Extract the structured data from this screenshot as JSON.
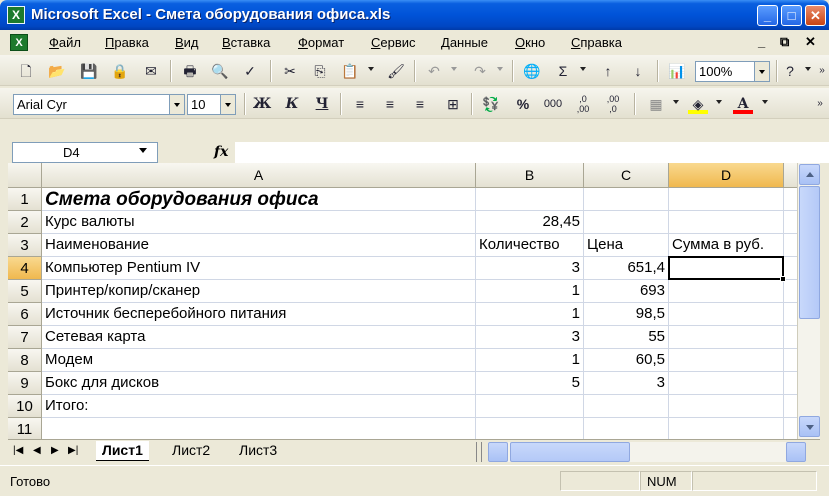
{
  "window": {
    "title": "Microsoft Excel - Смета оборудования офиса.xls",
    "app_icon": "X"
  },
  "menu": {
    "items": [
      "Файл",
      "Правка",
      "Вид",
      "Вставка",
      "Формат",
      "Сервис",
      "Данные",
      "Окно",
      "Справка"
    ],
    "doc_controls": {
      "min": "_",
      "restore": "ā",
      "close": "×"
    }
  },
  "toolbar1": {
    "zoom": "100%"
  },
  "toolbar2": {
    "font_name": "Arial Cyr",
    "font_size": "10",
    "bold": "Ж",
    "italic": "К",
    "underline": "Ч",
    "percent": "%",
    "thousands": "000",
    "inc_decimal": ",0 ,00",
    "dec_decimal": ",00 ,0"
  },
  "formula_bar": {
    "name_box": "D4",
    "fx_label": "fx",
    "formula": ""
  },
  "grid": {
    "columns": [
      "A",
      "B",
      "C",
      "D"
    ],
    "rows": [
      "1",
      "2",
      "3",
      "4",
      "5",
      "6",
      "7",
      "8",
      "9",
      "10",
      "11"
    ],
    "active_cell": "D4",
    "cells": {
      "A1": "Смета оборудования офиса",
      "A2": "Курс валюты",
      "B2": "28,45",
      "A3": "Наименование",
      "B3": "Количество",
      "C3": "Цена",
      "D3": "Сумма в руб.",
      "A4": "Компьютер Pentium IV",
      "B4": "3",
      "C4": "651,4",
      "A5": "Принтер/копир/сканер",
      "B5": "1",
      "C5": "693",
      "A6": "Источник бесперебойного питания",
      "B6": "1",
      "C6": "98,5",
      "A7": "Сетевая карта",
      "B7": "3",
      "C7": "55",
      "A8": "Модем",
      "B8": "1",
      "C8": "60,5",
      "A9": "Бокс для дисков",
      "B9": "5",
      "C9": "3",
      "A10": "Итого:"
    }
  },
  "sheets": {
    "tabs": [
      "Лист1",
      "Лист2",
      "Лист3"
    ],
    "active": "Лист1"
  },
  "status": {
    "text": "Готово",
    "num": "NUM"
  }
}
